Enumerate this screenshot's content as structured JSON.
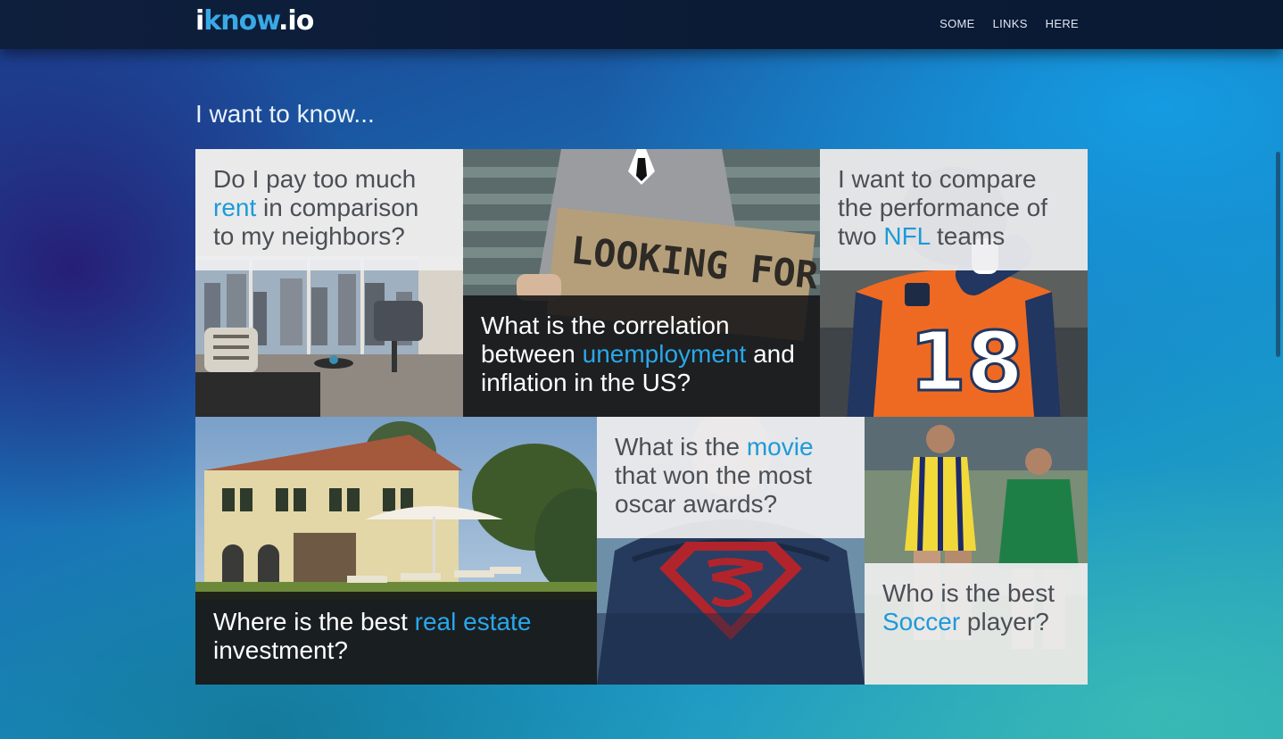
{
  "brand": {
    "prefix": "i",
    "middle": "know",
    "suffix": ".io"
  },
  "nav": {
    "links": [
      "SOME",
      "LINKS",
      "HERE"
    ]
  },
  "heading": "I want to know...",
  "tiles": [
    {
      "before": "Do I pay too much ",
      "highlight": "rent",
      "after": " in comparison to my neighbors?"
    },
    {
      "before": "What is the correlation between ",
      "highlight": "unemployment",
      "after": " and inflation in the US?",
      "sign_text": "LOOKING FOR A JOB"
    },
    {
      "before": "I want to compare the performance of two ",
      "highlight": "NFL",
      "after": " teams",
      "jersey_number": "18"
    },
    {
      "before": "Where is the best ",
      "highlight": "real estate",
      "after": " investment?"
    },
    {
      "before": "What is the ",
      "highlight": "movie",
      "after": " that won the most oscar awards?"
    },
    {
      "before": "Who is the best ",
      "highlight": "Soccer",
      "after": " player?"
    }
  ],
  "colors": {
    "accent": "#1d9ad9",
    "nav_bg": "#0e1f3d"
  }
}
